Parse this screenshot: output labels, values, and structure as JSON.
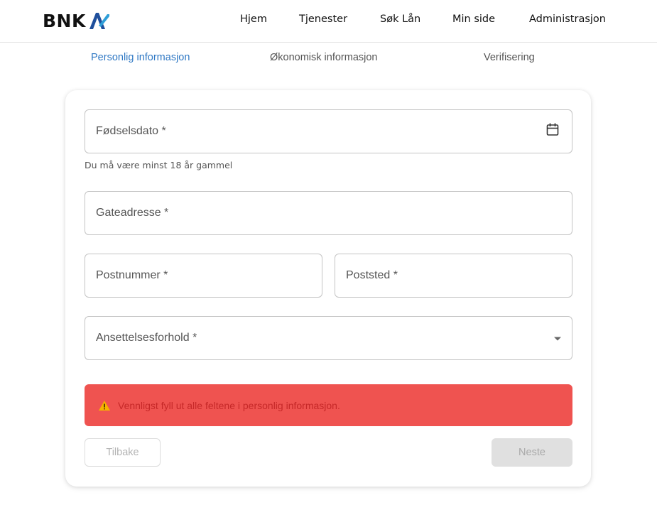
{
  "brand": {
    "name": "BNK",
    "mark_icon": "bnk-logo-mark",
    "accent": "#2f78c4"
  },
  "nav": {
    "items": [
      {
        "label": "Hjem"
      },
      {
        "label": "Tjenester"
      },
      {
        "label": "Søk Lån"
      },
      {
        "label": "Min side"
      },
      {
        "label": "Administrasjon"
      }
    ]
  },
  "stepper": {
    "steps": [
      {
        "label": "Personlig informasjon",
        "active": true
      },
      {
        "label": "Økonomisk informasjon",
        "active": false
      },
      {
        "label": "Verifisering",
        "active": false
      }
    ]
  },
  "form": {
    "birthdate": {
      "label": "Fødselsdato *",
      "helper": "Du må være minst 18 år gammel",
      "icon": "calendar-icon"
    },
    "street": {
      "label": "Gateadresse *"
    },
    "postal_code": {
      "label": "Postnummer *"
    },
    "city": {
      "label": "Poststed *"
    },
    "employment": {
      "label": "Ansettelsesforhold *",
      "icon": "dropdown-arrow-icon"
    }
  },
  "alert": {
    "message": "Vennligst fyll ut alle feltene i personlig informasjon.",
    "icon": "warning-icon",
    "color": "#ef5350"
  },
  "actions": {
    "back_label": "Tilbake",
    "next_label": "Neste"
  }
}
